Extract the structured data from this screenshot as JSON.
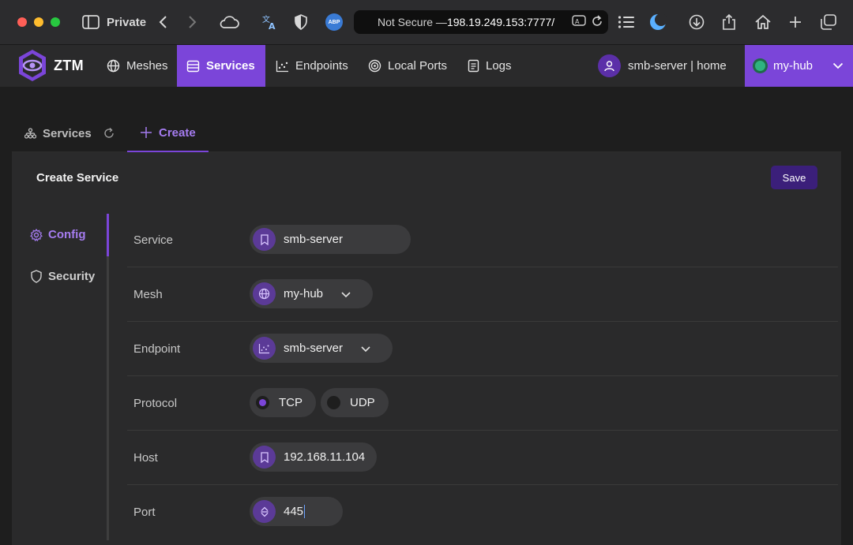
{
  "browser": {
    "private_label": "Private",
    "address_prefix": "Not Secure — ",
    "address_host": "198.19.249.153:7777/",
    "abp_badge": "ABP"
  },
  "nav": {
    "brand": "ZTM",
    "items": [
      {
        "label": "Meshes",
        "icon": "globe-icon"
      },
      {
        "label": "Services",
        "icon": "server-icon",
        "active": true
      },
      {
        "label": "Endpoints",
        "icon": "scatter-chart-icon"
      },
      {
        "label": "Local Ports",
        "icon": "target-icon"
      },
      {
        "label": "Logs",
        "icon": "document-icon"
      }
    ],
    "user": "smb-server | home",
    "hub": "my-hub"
  },
  "tabs": {
    "services": "Services",
    "create": "Create"
  },
  "card": {
    "title": "Create Service",
    "save": "Save",
    "side_menu": [
      {
        "label": "Config",
        "icon": "gear-icon",
        "active": true
      },
      {
        "label": "Security",
        "icon": "shield-icon"
      }
    ]
  },
  "form": {
    "service": {
      "label": "Service",
      "value": "smb-server"
    },
    "mesh": {
      "label": "Mesh",
      "value": "my-hub"
    },
    "endpoint": {
      "label": "Endpoint",
      "value": "smb-server"
    },
    "protocol": {
      "label": "Protocol",
      "options": [
        "TCP",
        "UDP"
      ],
      "selected": "TCP"
    },
    "host": {
      "label": "Host",
      "value": "192.168.11.104"
    },
    "port": {
      "label": "Port",
      "value": "445"
    }
  },
  "colors": {
    "accent": "#7b45d9",
    "accent_dark": "#3b1f7a",
    "background": "#1e1e1e",
    "panel": "#2a2a2b",
    "hub_status": "#2fb380"
  }
}
